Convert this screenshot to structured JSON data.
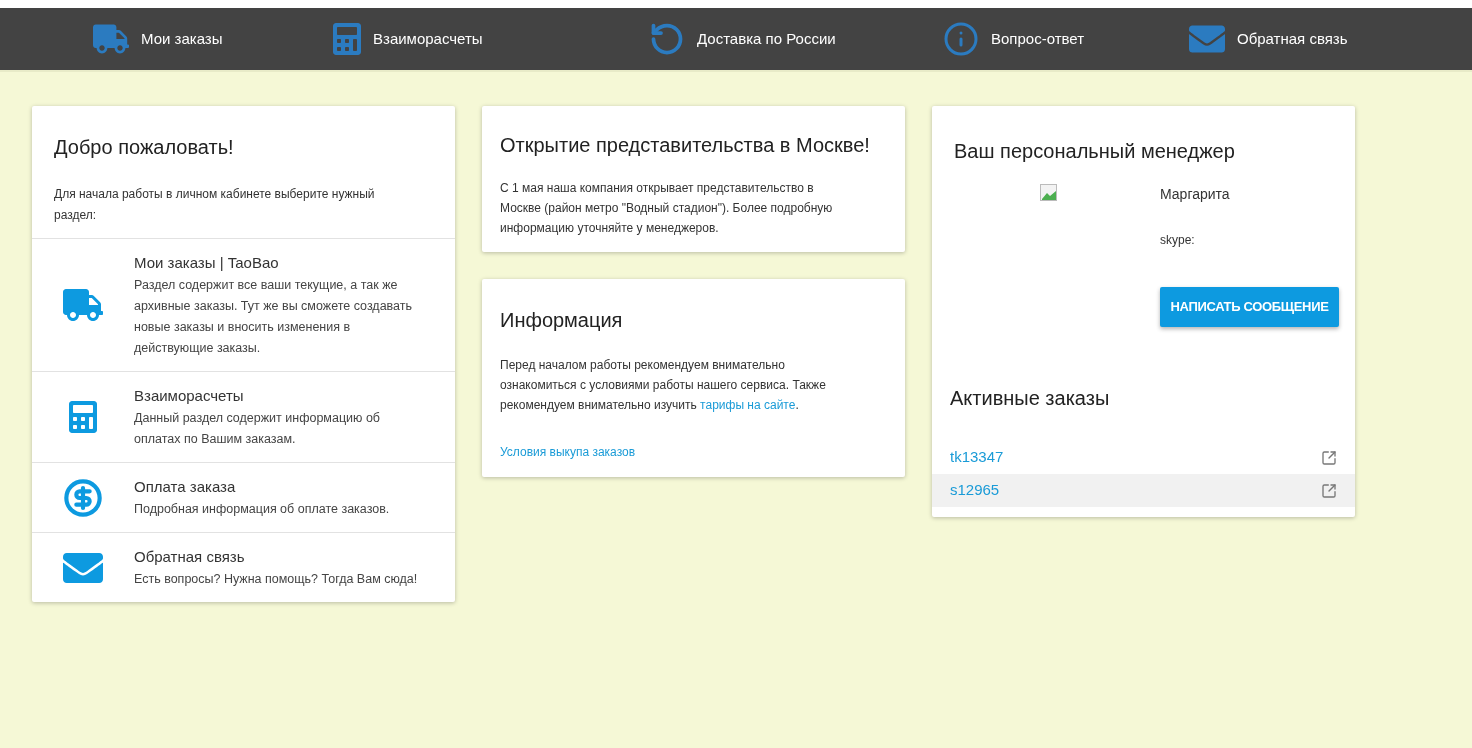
{
  "nav": [
    {
      "kind": "truck",
      "label": "Мои заказы"
    },
    {
      "kind": "calculator",
      "label": "Взаиморасчеты"
    },
    {
      "kind": "rotate",
      "label": "Доставка по России"
    },
    {
      "kind": "info",
      "label": "Вопрос-ответ"
    },
    {
      "kind": "mail",
      "label": "Обратная связь"
    }
  ],
  "welcome": {
    "title": "Добро пожаловать!",
    "intro": "Для начала работы в личном кабинете выберите нужный раздел:",
    "sections": [
      {
        "kind": "truck",
        "title": "Мои заказы | TaoBao",
        "text": "Раздел содержит все ваши текущие, а так же архивные заказы. Тут же вы сможете создавать новые заказы и вносить изменения в действующие заказы."
      },
      {
        "kind": "calculator",
        "title": "Взаиморасчеты",
        "text": "Данный раздел содержит информацию об оплатах по Вашим заказам."
      },
      {
        "kind": "dollar",
        "title": "Оплата заказа",
        "text": "Подробная информация об оплате заказов."
      },
      {
        "kind": "mail",
        "title": "Обратная связь",
        "text": "Есть вопросы? Нужна помощь? Тогда Вам сюда!"
      }
    ]
  },
  "news": {
    "title": "Открытие представительства в Москве!",
    "text": "С 1 мая наша компания открывает представительство в Москве (район метро \"Водный стадион\"). Более подробную информацию уточняйте у менеджеров."
  },
  "info": {
    "title": "Информация",
    "text_before": "Перед началом работы рекомендуем внимательно ознакомиться с условиями работы нашего сервиса. Также рекомендуем внимательно изучить ",
    "link": "тарифы на сайте",
    "text_after": ".",
    "footer_link": "Условия выкупа заказов"
  },
  "manager": {
    "title": "Ваш персональный менеджер",
    "name": "Маргарита",
    "skype": "skype:",
    "button": "НАПИСАТЬ СООБЩЕНИЕ"
  },
  "active_orders": {
    "title": "Активные заказы",
    "orders": [
      {
        "id": "tk13347",
        "selected": false
      },
      {
        "id": "s12965",
        "selected": true
      }
    ]
  }
}
